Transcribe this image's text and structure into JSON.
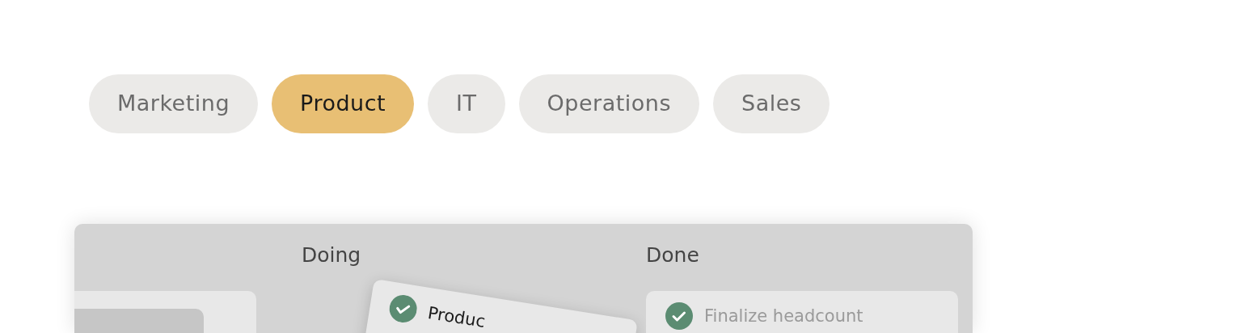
{
  "tabs": [
    {
      "label": "Marketing",
      "selected": false
    },
    {
      "label": "Product",
      "selected": true
    },
    {
      "label": "IT",
      "selected": false
    },
    {
      "label": "Operations",
      "selected": false
    },
    {
      "label": "Sales",
      "selected": false
    }
  ],
  "board": {
    "columns": [
      {
        "cards": [
          {
            "kind": "placeholder"
          }
        ]
      },
      {
        "title": "Doing",
        "cards": [
          {
            "kind": "task",
            "title": "Produc",
            "done": true,
            "dragging": true
          }
        ]
      },
      {
        "title": "Done",
        "cards": [
          {
            "kind": "task",
            "title": "Finalize headcount",
            "done": true,
            "dragging": false
          }
        ]
      }
    ]
  }
}
